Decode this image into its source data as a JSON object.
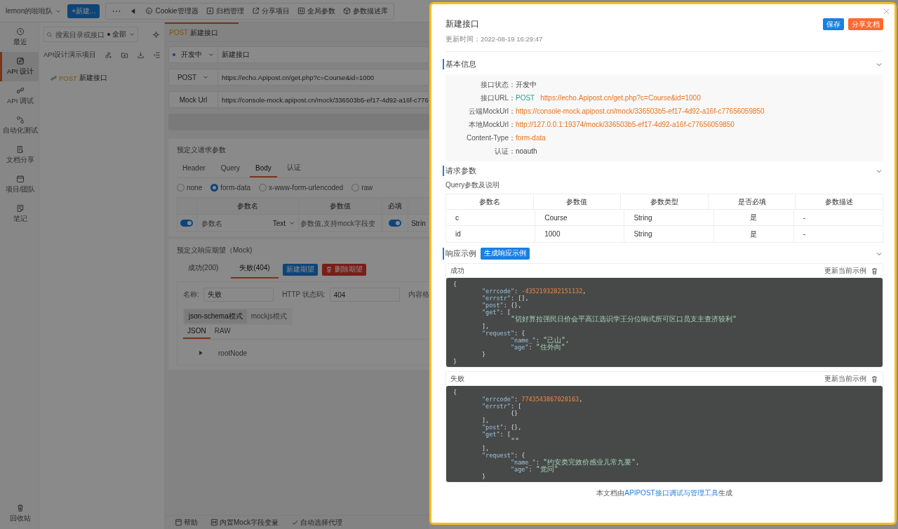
{
  "topbar": {
    "team": "lemon的啦啦队",
    "new_button": "+新建...",
    "tools": [
      "Cookie管理器",
      "归档管理",
      "分享项目",
      "全局参数",
      "参数描述库"
    ]
  },
  "nav": {
    "items": [
      {
        "label": "最近",
        "selected": false
      },
      {
        "label": "API 设计",
        "selected": true
      },
      {
        "label": "API 调试",
        "selected": false
      },
      {
        "label": "自动化测试",
        "selected": false
      },
      {
        "label": "文档分享",
        "selected": false
      },
      {
        "label": "项目/团队",
        "selected": false
      },
      {
        "label": "笔记",
        "selected": false
      }
    ],
    "bottom": "回收站"
  },
  "tree": {
    "search_placeholder": "搜索目录或接口",
    "filter": "全部",
    "project": "API设计演示项目",
    "items": [
      {
        "method": "POST",
        "name": "新建接口"
      }
    ]
  },
  "editor": {
    "tabs": [
      {
        "method": "POST",
        "name": "新建接口",
        "selected": true
      }
    ],
    "status": "开发中",
    "name": "新建接口",
    "method": "POST",
    "url": "https://echo.Apipost.cn/get.php?c=Course&id=1000",
    "mock_label": "Mock Url",
    "mock_url": "https://console-mock.apipost.cn/mock/336503b5-ef17-4d92-a16f-c776",
    "request": {
      "title": "预定义请求参数",
      "tabs": [
        {
          "label": "Header",
          "selected": false
        },
        {
          "label": "Query",
          "selected": false
        },
        {
          "label": "Body",
          "selected": true
        },
        {
          "label": "认证",
          "selected": false
        }
      ],
      "body_types": [
        {
          "label": "none",
          "selected": false
        },
        {
          "label": "form-data",
          "selected": true
        },
        {
          "label": "x-www-form-urlencoded",
          "selected": false
        },
        {
          "label": "raw",
          "selected": false
        }
      ],
      "columns": [
        "参数名",
        "参数值",
        "必填"
      ],
      "rows": [
        {
          "enabled": true,
          "name_placeholder": "参数名",
          "type": "Text",
          "value_placeholder": "参数值,支持mock字段变",
          "required": true,
          "column_4": "Strin"
        }
      ]
    },
    "mock": {
      "title": "预定义响应期望（Mock)",
      "tabs": [
        {
          "label": "成功(200)",
          "selected": false
        },
        {
          "label": "失败(404)",
          "selected": true
        }
      ],
      "buttons": [
        {
          "kind": "primary",
          "label": "新建期望"
        },
        {
          "kind": "danger",
          "label": "删除期望"
        }
      ],
      "fields": [
        {
          "label": "名称:",
          "value": "失败"
        },
        {
          "label": "HTTP 状态码:",
          "value": "404"
        },
        {
          "label": "内容格"
        }
      ],
      "modes": [
        {
          "label": "json-schema模式",
          "selected": true
        },
        {
          "label": "mockjs模式",
          "selected": false
        }
      ],
      "formats": [
        {
          "label": "JSON",
          "selected": true
        },
        {
          "label": "RAW",
          "selected": false
        }
      ],
      "root_node": "rootNode"
    },
    "footer": [
      "帮助",
      "内置Mock字段变量",
      "自动选择代理"
    ]
  },
  "doc": {
    "title": "新建接口",
    "updated": "更新时间：2022-08-19 16:29:47",
    "buttons": [
      {
        "kind": "primary",
        "label": "保存"
      },
      {
        "kind": "warning",
        "label": "分享文档"
      }
    ],
    "basic": {
      "title": "基本信息",
      "rows": [
        {
          "label": "接口状态：",
          "kind": "plain",
          "value": "开发中"
        },
        {
          "label": "接口URL：",
          "kind": "link",
          "method": "POST",
          "value": "https://echo.Apipost.cn/get.php?c=Course&id=1000"
        },
        {
          "label": "云端MockUrl：",
          "kind": "link",
          "value": "https://console-mock.apipost.cn/mock/336503b5-ef17-4d92-a16f-c77656059850"
        },
        {
          "label": "本地MockUrl：",
          "kind": "link",
          "value": "http://127.0.0.1:19374/mock/336503b5-ef17-4d92-a16f-c77656059850"
        },
        {
          "label": "Content-Type：",
          "kind": "link",
          "value": "form-data"
        },
        {
          "label": "认证：",
          "kind": "plain",
          "value": "noauth"
        }
      ]
    },
    "params": {
      "title": "请求参数",
      "subtitle": "Query参数及说明",
      "columns": [
        "参数名",
        "参数值",
        "参数类型",
        "是否必填",
        "参数描述"
      ],
      "rows": [
        [
          "c",
          "Course",
          "String",
          "是",
          "-"
        ],
        [
          "id",
          "1000",
          "String",
          "是",
          "-"
        ]
      ]
    },
    "examples": {
      "title": "响应示例",
      "generate_button": "生成响应示例",
      "items": [
        {
          "name": "成功",
          "update": "更新当前示例",
          "code": [
            "{",
            "        \"errcode\": -4352193282151132,",
            "        \"errstr\": [],",
            "        \"post\": {},",
            "        \"get\": [",
            "                \"切好算拉强民日价会平高江选识学王分位响式所可区口员支主查济较利\"",
            "        ],",
            "        \"request\": {",
            "                \"name_\": \"己山\",",
            "                \"age\": \"住外向\"",
            "        }",
            "}"
          ]
        },
        {
          "name": "失败",
          "update": "更新当前示例",
          "code": [
            "{",
            "        \"errcode\": 7743543867028163,",
            "        \"errstr\": [",
            "                {}",
            "        ],",
            "        \"post\": {},",
            "        \"get\": [",
            "                \"\"",
            "        ],",
            "        \"request\": {",
            "                \"name_\": \"约安类完效价感业儿常九要\",",
            "                \"age\": \"党问\"",
            "        }"
          ]
        }
      ]
    },
    "footer": {
      "before": "本文档由",
      "link": "APIPOST接口调试与管理工具",
      "after": "生成"
    }
  }
}
